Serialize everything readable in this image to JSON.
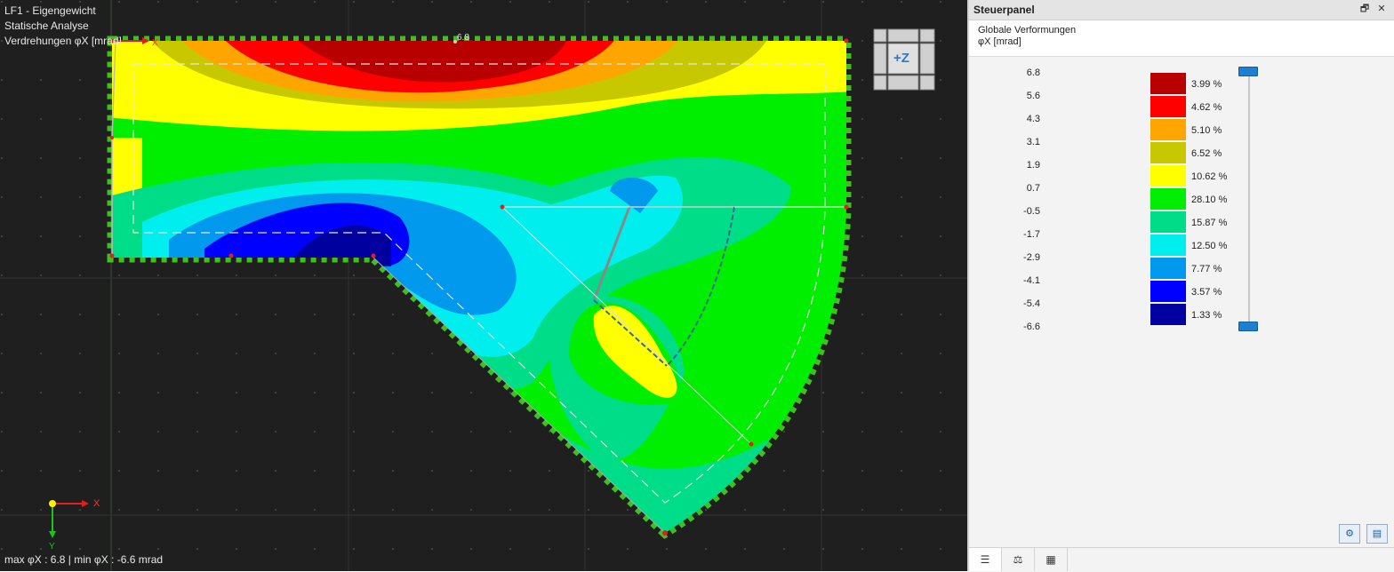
{
  "viewport": {
    "info_lines": [
      "LF1 - Eigengewicht",
      "Statische Analyse",
      "Verdrehungen φX [mrad]"
    ],
    "max_label": "6.8",
    "status_text": "max φX : 6.8 | min φX : -6.6 mrad",
    "nav_cube_label": "+Z",
    "axis_x": "X",
    "axis_y": "Y",
    "colors": {
      "background": "#1f1f1f",
      "boundary": "#3fc020",
      "axis_x": "#e02020",
      "axis_y": "#20c020"
    }
  },
  "panel": {
    "title": "Steuerpanel",
    "header_icons": [
      "restore-icon",
      "close-icon"
    ],
    "subtitle_1": "Globale Verformungen",
    "subtitle_2": "φX [mrad]",
    "legend_values": [
      "6.8",
      "5.6",
      "4.3",
      "3.1",
      "1.9",
      "0.7",
      "-0.5",
      "-1.7",
      "-2.9",
      "-4.1",
      "-5.4",
      "-6.6"
    ],
    "legend_entries": [
      {
        "color": "#b80000",
        "percent": "3.99 %"
      },
      {
        "color": "#ff0000",
        "percent": "4.62 %"
      },
      {
        "color": "#ffa500",
        "percent": "5.10 %"
      },
      {
        "color": "#c8c800",
        "percent": "6.52 %"
      },
      {
        "color": "#ffff00",
        "percent": "10.62 %"
      },
      {
        "color": "#00ee00",
        "percent": "28.10 %"
      },
      {
        "color": "#00dd88",
        "percent": "15.87 %"
      },
      {
        "color": "#00eeee",
        "percent": "12.50 %"
      },
      {
        "color": "#0099ee",
        "percent": "7.77 %"
      },
      {
        "color": "#0000ff",
        "percent": "3.57 %"
      },
      {
        "color": "#00009e",
        "percent": "1.33 %"
      }
    ],
    "bottom_tools": [
      "settings-icon",
      "legend-toggle-icon"
    ],
    "tabs": [
      "legend-tab-icon",
      "balance-tab-icon",
      "filter-tab-icon"
    ],
    "accent": "#1e7fd0"
  }
}
